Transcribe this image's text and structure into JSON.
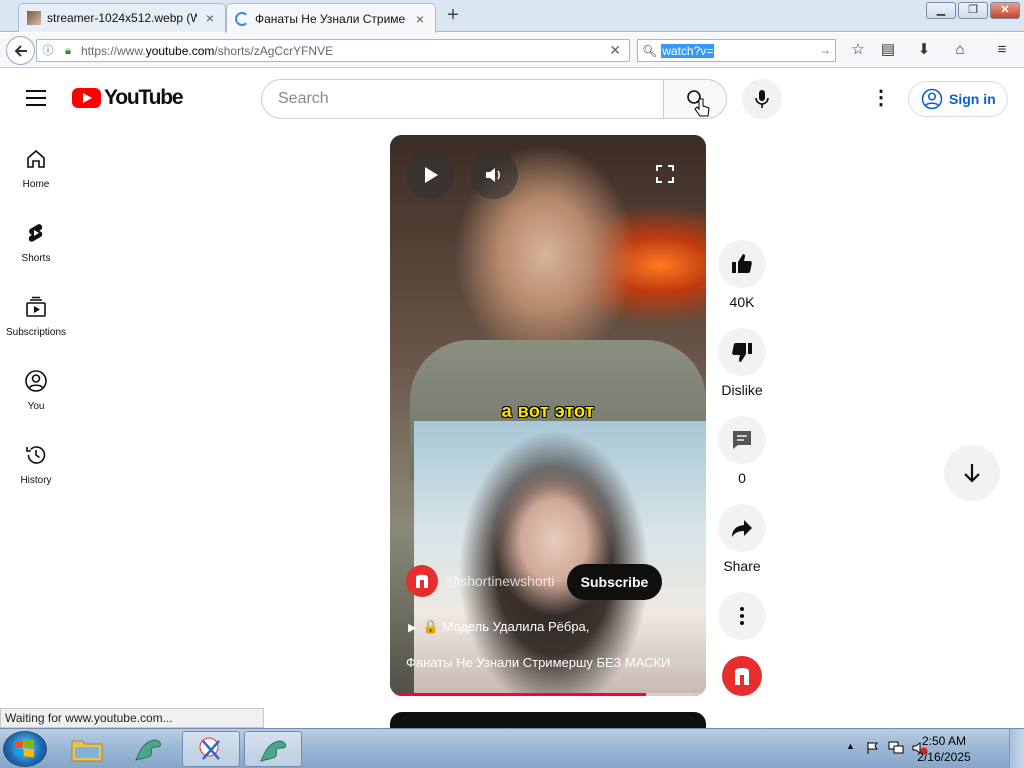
{
  "browser": {
    "tabs": [
      {
        "label": "streamer-1024x512.webp (W",
        "close": "×"
      },
      {
        "label": "Фанаты Не Узнали Стриме",
        "close": "×"
      }
    ],
    "new_tab": "+",
    "url_prefix": "https://www.",
    "url_domain": "youtube.com",
    "url_suffix": "/shorts/zAgCcrYFNVE",
    "search_value": "watch?v=",
    "status_text": "Waiting for www.youtube.com..."
  },
  "youtube": {
    "logo_text": "YouTube",
    "search_placeholder": "Search",
    "signin_label": "Sign in",
    "guide": [
      {
        "label": "Home"
      },
      {
        "label": "Shorts"
      },
      {
        "label": "Subscriptions"
      },
      {
        "label": "You"
      },
      {
        "label": "History"
      }
    ],
    "short": {
      "caption": "а вот этот",
      "channel": "@shortinewshorti",
      "subscribe_label": "Subscribe",
      "title_line1": "🔒 Модель Удалила Рёбра,",
      "title_line2": "Фанаты Не Узнали Стримершу БЕЗ МАСКИ",
      "progress": 0.81
    },
    "actions": {
      "like_count": "40K",
      "dislike_label": "Dislike",
      "comments_count": "0",
      "share_label": "Share"
    },
    "colors": {
      "brand": "#ff0000",
      "link": "#065fd4",
      "progress": "#ff0033"
    }
  },
  "taskbar": {
    "time": "2:50 AM",
    "date": "2/16/2025"
  }
}
